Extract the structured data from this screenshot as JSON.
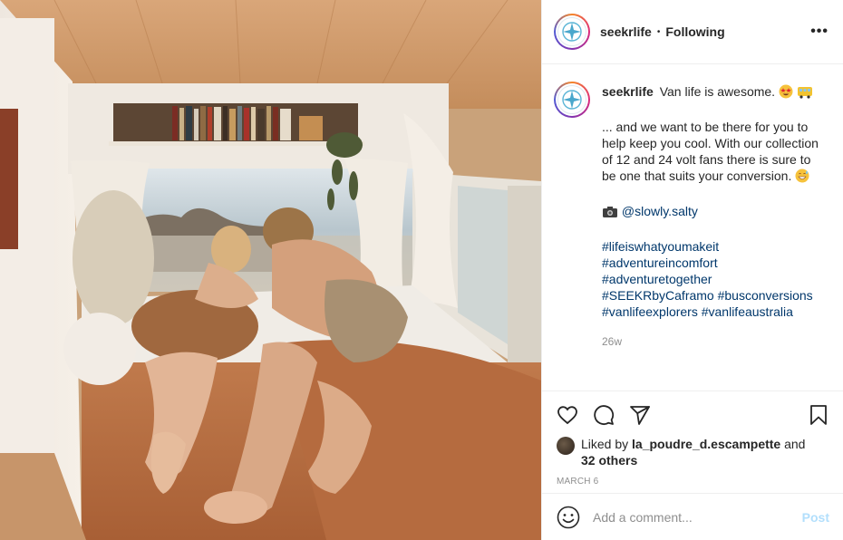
{
  "post": {
    "username": "seekrlife",
    "separator": "•",
    "follow_status": "Following",
    "more_icon": "more-horizontal-icon"
  },
  "caption": {
    "username": "seekrlife",
    "line1": "Van life is awesome.",
    "line1_emojis": [
      "star-struck-emoji",
      "bus-emoji"
    ],
    "body": "... and we want to be there for you to help keep you cool. With our collection of 12 and 24 volt fans there is sure to be one that suits your conversion.",
    "body_emoji": "grinning-sweat-emoji",
    "credit_icon": "camera-emoji",
    "credit_handle": "@slowly.salty",
    "hashtags": [
      "#lifeiswhatyoumakeit",
      "#adventureincomfort",
      "#adventuretogether",
      "#SEEKRbyCaframo #busconversions",
      "#vanlifeexplorers #vanlifeaustralia"
    ],
    "age": "26w"
  },
  "actions": {
    "icons": [
      "heart-icon",
      "comment-icon",
      "share-icon",
      "bookmark-icon"
    ],
    "liked_prefix": "Liked by",
    "liked_user": "la_poudre_d.escampette",
    "liked_and": "and",
    "liked_others": "32 others",
    "date": "MARCH 6"
  },
  "comment_box": {
    "placeholder": "Add a comment...",
    "post_label": "Post"
  },
  "colors": {
    "link": "#00376b",
    "post_disabled": "#b2dffc",
    "meta": "#8e8e8e",
    "text": "#262626"
  }
}
